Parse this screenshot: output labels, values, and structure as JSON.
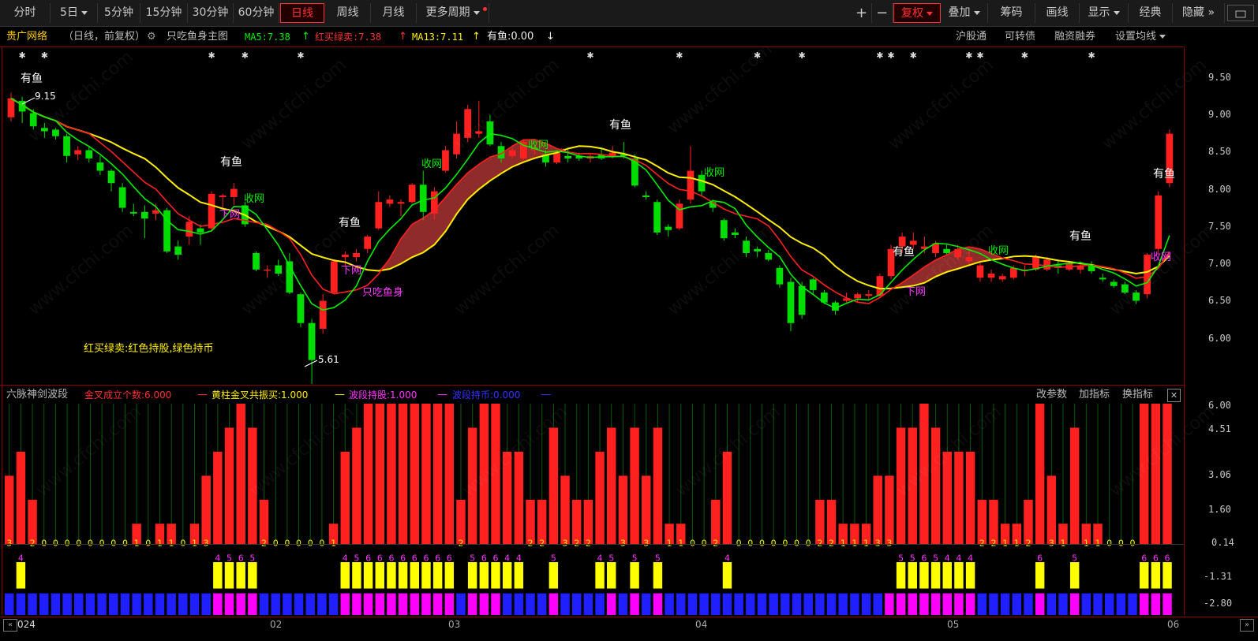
{
  "toolbar": {
    "left_tabs": [
      "分时",
      "5日",
      "5分钟",
      "15分钟",
      "30分钟",
      "60分钟",
      "日线",
      "周线",
      "月线",
      "更多周期"
    ],
    "active_tab": "日线",
    "right_buttons": [
      "复权",
      "叠加",
      "筹码",
      "画线",
      "显示",
      "经典",
      "隐藏"
    ],
    "plus": "+",
    "minus": "−",
    "hide_arrows": "»"
  },
  "info": {
    "stock_name": "贵广网络",
    "period": "（日线，前复权）",
    "template": "只吃鱼身主图",
    "ma5": "MA5:7.38",
    "hmlm": "红买绿卖:7.38",
    "ma13": "MA13:7.11",
    "youyu": "有鱼:0.00",
    "links": [
      "沪股通",
      "可转债",
      "融资融券",
      "设置均线"
    ]
  },
  "indicator": {
    "name": "六脉神剑波段",
    "l1": "金叉成立个数:6.000",
    "l2": "黄柱金叉共振买:1.000",
    "l3": "波段持股:1.000",
    "l4": "波段持币:0.000",
    "dash": "—",
    "actions": [
      "改参数",
      "加指标",
      "换指标"
    ],
    "close": "✕"
  },
  "axis": {
    "main": [
      "9.50",
      "9.00",
      "8.50",
      "8.00",
      "7.50",
      "7.00",
      "6.50",
      "6.00"
    ],
    "sub": [
      "6.00",
      "4.51",
      "3.06",
      "1.60",
      "0.14",
      "-1.31",
      "-2.80"
    ]
  },
  "dates": [
    "024",
    "02",
    "03",
    "04",
    "05",
    "06"
  ],
  "annotations": {
    "high": "9.15",
    "low": "5.61",
    "legend": "红买绿卖:红色持股,绿色持币",
    "youyu": "有鱼",
    "shouwang": "收网",
    "xiawang": "下网",
    "zcys": "只吃鱼身"
  },
  "watermark": "www.cfchi.com",
  "colors": {
    "up": "#ff2020",
    "down": "#00dd00",
    "ma5": "#00ee00",
    "ma13": "#ffee00",
    "red_line": "#ff2020",
    "band": "#a83232",
    "yellow": "#ffff00",
    "magenta": "#ff00ff",
    "blue": "#1f1fff",
    "grid": "#8b0000"
  },
  "chart_data": [
    {
      "type": "candlestick",
      "title": "贵广网络 日线 前复权",
      "y_range": [
        5.6,
        9.7
      ],
      "candles": [
        {
          "o": 8.85,
          "h": 9.15,
          "l": 8.8,
          "c": 9.08
        },
        {
          "o": 9.05,
          "h": 9.1,
          "l": 8.78,
          "c": 8.92
        },
        {
          "o": 8.9,
          "h": 8.95,
          "l": 8.7,
          "c": 8.74
        },
        {
          "o": 8.72,
          "h": 8.78,
          "l": 8.6,
          "c": 8.68
        },
        {
          "o": 8.7,
          "h": 8.72,
          "l": 8.58,
          "c": 8.62
        },
        {
          "o": 8.62,
          "h": 8.65,
          "l": 8.3,
          "c": 8.38
        },
        {
          "o": 8.4,
          "h": 8.5,
          "l": 8.33,
          "c": 8.45
        },
        {
          "o": 8.45,
          "h": 8.5,
          "l": 8.3,
          "c": 8.35
        },
        {
          "o": 8.3,
          "h": 8.38,
          "l": 8.15,
          "c": 8.2
        },
        {
          "o": 8.2,
          "h": 8.22,
          "l": 7.95,
          "c": 8.05
        },
        {
          "o": 8.0,
          "h": 8.05,
          "l": 7.7,
          "c": 7.75
        },
        {
          "o": 7.7,
          "h": 7.8,
          "l": 7.65,
          "c": 7.68
        },
        {
          "o": 7.7,
          "h": 7.78,
          "l": 7.38,
          "c": 7.62
        },
        {
          "o": 7.68,
          "h": 7.8,
          "l": 7.6,
          "c": 7.72
        },
        {
          "o": 7.72,
          "h": 7.75,
          "l": 7.2,
          "c": 7.22
        },
        {
          "o": 7.28,
          "h": 7.35,
          "l": 7.12,
          "c": 7.18
        },
        {
          "o": 7.4,
          "h": 7.65,
          "l": 7.3,
          "c": 7.58
        },
        {
          "o": 7.5,
          "h": 7.55,
          "l": 7.3,
          "c": 7.45
        },
        {
          "o": 7.5,
          "h": 7.95,
          "l": 7.48,
          "c": 7.92
        },
        {
          "o": 7.88,
          "h": 7.92,
          "l": 7.75,
          "c": 7.9
        },
        {
          "o": 7.88,
          "h": 8.05,
          "l": 7.78,
          "c": 7.98
        },
        {
          "o": 7.78,
          "h": 7.82,
          "l": 7.52,
          "c": 7.55
        },
        {
          "o": 7.2,
          "h": 7.22,
          "l": 6.98,
          "c": 7.0
        },
        {
          "o": 7.0,
          "h": 7.05,
          "l": 6.9,
          "c": 7.0
        },
        {
          "o": 7.05,
          "h": 7.12,
          "l": 6.92,
          "c": 6.95
        },
        {
          "o": 7.1,
          "h": 7.2,
          "l": 6.7,
          "c": 6.72
        },
        {
          "o": 6.7,
          "h": 6.72,
          "l": 6.3,
          "c": 6.35
        },
        {
          "o": 6.35,
          "h": 6.4,
          "l": 5.61,
          "c": 5.9
        },
        {
          "o": 6.28,
          "h": 6.7,
          "l": 6.22,
          "c": 6.62
        },
        {
          "o": 6.72,
          "h": 7.12,
          "l": 6.7,
          "c": 7.1
        },
        {
          "o": 7.15,
          "h": 7.22,
          "l": 7.05,
          "c": 7.18
        },
        {
          "o": 7.15,
          "h": 7.25,
          "l": 7.1,
          "c": 7.2
        },
        {
          "o": 7.25,
          "h": 7.42,
          "l": 7.2,
          "c": 7.4
        },
        {
          "o": 7.5,
          "h": 7.95,
          "l": 7.48,
          "c": 7.82
        },
        {
          "o": 7.8,
          "h": 7.9,
          "l": 7.76,
          "c": 7.85
        },
        {
          "o": 7.8,
          "h": 7.85,
          "l": 7.65,
          "c": 7.82
        },
        {
          "o": 7.82,
          "h": 8.05,
          "l": 7.8,
          "c": 8.03
        },
        {
          "o": 8.03,
          "h": 8.2,
          "l": 7.6,
          "c": 7.7
        },
        {
          "o": 7.68,
          "h": 8.0,
          "l": 7.6,
          "c": 7.95
        },
        {
          "o": 8.2,
          "h": 8.5,
          "l": 8.18,
          "c": 8.45
        },
        {
          "o": 8.4,
          "h": 8.8,
          "l": 8.35,
          "c": 8.65
        },
        {
          "o": 8.6,
          "h": 9.0,
          "l": 8.55,
          "c": 8.95
        },
        {
          "o": 8.65,
          "h": 9.05,
          "l": 8.6,
          "c": 8.68
        },
        {
          "o": 8.8,
          "h": 8.88,
          "l": 8.5,
          "c": 8.52
        },
        {
          "o": 8.5,
          "h": 8.55,
          "l": 8.3,
          "c": 8.35
        },
        {
          "o": 8.38,
          "h": 8.48,
          "l": 8.35,
          "c": 8.45
        },
        {
          "o": 8.35,
          "h": 8.58,
          "l": 8.33,
          "c": 8.55
        },
        {
          "o": 8.45,
          "h": 8.5,
          "l": 8.4,
          "c": 8.48
        },
        {
          "o": 8.4,
          "h": 8.45,
          "l": 8.25,
          "c": 8.3
        },
        {
          "o": 8.3,
          "h": 8.45,
          "l": 8.28,
          "c": 8.42
        },
        {
          "o": 8.38,
          "h": 8.48,
          "l": 8.3,
          "c": 8.35
        },
        {
          "o": 8.38,
          "h": 8.42,
          "l": 8.32,
          "c": 8.35
        },
        {
          "o": 8.35,
          "h": 8.4,
          "l": 8.3,
          "c": 8.38
        },
        {
          "o": 8.4,
          "h": 8.48,
          "l": 8.33,
          "c": 8.35
        },
        {
          "o": 8.38,
          "h": 8.5,
          "l": 8.35,
          "c": 8.42
        },
        {
          "o": 8.4,
          "h": 8.55,
          "l": 8.35,
          "c": 8.38
        },
        {
          "o": 8.35,
          "h": 8.4,
          "l": 8.0,
          "c": 8.02
        },
        {
          "o": 7.9,
          "h": 7.95,
          "l": 7.85,
          "c": 7.88
        },
        {
          "o": 7.82,
          "h": 7.85,
          "l": 7.42,
          "c": 7.45
        },
        {
          "o": 7.52,
          "h": 7.55,
          "l": 7.4,
          "c": 7.48
        },
        {
          "o": 7.5,
          "h": 7.85,
          "l": 7.48,
          "c": 7.8
        },
        {
          "o": 7.85,
          "h": 8.5,
          "l": 7.8,
          "c": 8.2
        },
        {
          "o": 8.15,
          "h": 8.2,
          "l": 7.9,
          "c": 7.95
        },
        {
          "o": 7.82,
          "h": 7.85,
          "l": 7.7,
          "c": 7.75
        },
        {
          "o": 7.6,
          "h": 7.62,
          "l": 7.35,
          "c": 7.38
        },
        {
          "o": 7.45,
          "h": 7.5,
          "l": 7.38,
          "c": 7.42
        },
        {
          "o": 7.35,
          "h": 7.4,
          "l": 7.15,
          "c": 7.2
        },
        {
          "o": 7.25,
          "h": 7.28,
          "l": 7.15,
          "c": 7.22
        },
        {
          "o": 7.2,
          "h": 7.24,
          "l": 7.1,
          "c": 7.12
        },
        {
          "o": 7.02,
          "h": 7.05,
          "l": 6.78,
          "c": 6.82
        },
        {
          "o": 6.85,
          "h": 6.9,
          "l": 6.25,
          "c": 6.35
        },
        {
          "o": 6.8,
          "h": 6.85,
          "l": 6.4,
          "c": 6.45
        },
        {
          "o": 6.88,
          "h": 6.9,
          "l": 6.7,
          "c": 6.75
        },
        {
          "o": 6.72,
          "h": 6.75,
          "l": 6.58,
          "c": 6.6
        },
        {
          "o": 6.6,
          "h": 6.62,
          "l": 6.45,
          "c": 6.5
        },
        {
          "o": 6.62,
          "h": 6.72,
          "l": 6.6,
          "c": 6.65
        },
        {
          "o": 6.65,
          "h": 6.72,
          "l": 6.6,
          "c": 6.7
        },
        {
          "o": 6.68,
          "h": 6.75,
          "l": 6.62,
          "c": 6.7
        },
        {
          "o": 6.68,
          "h": 6.95,
          "l": 6.66,
          "c": 6.92
        },
        {
          "o": 6.92,
          "h": 7.3,
          "l": 6.88,
          "c": 7.25
        },
        {
          "o": 7.28,
          "h": 7.45,
          "l": 7.2,
          "c": 7.4
        },
        {
          "o": 7.3,
          "h": 7.45,
          "l": 7.25,
          "c": 7.35
        },
        {
          "o": 7.25,
          "h": 7.4,
          "l": 7.2,
          "c": 7.28
        },
        {
          "o": 7.2,
          "h": 7.35,
          "l": 7.15,
          "c": 7.32
        },
        {
          "o": 7.25,
          "h": 7.3,
          "l": 7.18,
          "c": 7.2
        },
        {
          "o": 7.15,
          "h": 7.3,
          "l": 7.12,
          "c": 7.25
        },
        {
          "o": 7.1,
          "h": 7.25,
          "l": 7.05,
          "c": 7.15
        },
        {
          "o": 6.9,
          "h": 7.1,
          "l": 6.85,
          "c": 7.05
        },
        {
          "o": 6.9,
          "h": 7.0,
          "l": 6.85,
          "c": 6.95
        },
        {
          "o": 6.88,
          "h": 6.95,
          "l": 6.85,
          "c": 6.92
        },
        {
          "o": 6.9,
          "h": 7.05,
          "l": 6.88,
          "c": 7.02
        },
        {
          "o": 6.98,
          "h": 7.05,
          "l": 6.92,
          "c": 7.0
        },
        {
          "o": 7.0,
          "h": 7.18,
          "l": 6.98,
          "c": 7.15
        },
        {
          "o": 7.0,
          "h": 7.15,
          "l": 6.98,
          "c": 7.12
        },
        {
          "o": 7.05,
          "h": 7.12,
          "l": 6.95,
          "c": 7.02
        },
        {
          "o": 7.0,
          "h": 7.1,
          "l": 6.98,
          "c": 7.08
        },
        {
          "o": 7.0,
          "h": 7.1,
          "l": 6.95,
          "c": 7.05
        },
        {
          "o": 7.05,
          "h": 7.1,
          "l": 6.95,
          "c": 6.98
        },
        {
          "o": 6.9,
          "h": 6.95,
          "l": 6.85,
          "c": 6.88
        },
        {
          "o": 6.85,
          "h": 6.88,
          "l": 6.78,
          "c": 6.8
        },
        {
          "o": 6.82,
          "h": 6.85,
          "l": 6.7,
          "c": 6.72
        },
        {
          "o": 6.72,
          "h": 6.75,
          "l": 6.58,
          "c": 6.62
        },
        {
          "o": 6.7,
          "h": 7.2,
          "l": 6.65,
          "c": 7.18
        },
        {
          "o": 7.25,
          "h": 7.95,
          "l": 7.2,
          "c": 7.9
        },
        {
          "o": 8.05,
          "h": 8.7,
          "l": 8.0,
          "c": 8.65
        }
      ],
      "series_styles": {
        "ma5": "green",
        "ma13": "yellow",
        "red": "red"
      }
    },
    {
      "type": "bar",
      "title": "六脉神剑波段",
      "y_range": [
        -2.8,
        6.0
      ],
      "values": [
        3,
        4,
        2,
        0,
        0,
        0,
        0,
        0,
        0,
        0,
        0,
        1,
        0,
        1,
        1,
        0,
        1,
        3,
        4,
        5,
        6,
        5,
        2,
        0,
        0,
        0,
        0,
        0,
        1,
        4,
        5,
        6,
        6,
        6,
        6,
        6,
        6,
        6,
        6,
        2,
        5,
        6,
        6,
        4,
        4,
        2,
        2,
        5,
        3,
        2,
        2,
        4,
        5,
        3,
        5,
        3,
        5,
        1,
        1,
        0,
        0,
        2,
        4,
        0,
        0,
        0,
        0,
        0,
        0,
        0,
        2,
        2,
        1,
        1,
        1,
        3,
        3,
        5,
        5,
        6,
        5,
        4,
        4,
        4,
        2,
        2,
        1,
        1,
        2,
        6,
        3,
        1,
        5,
        1,
        1,
        0,
        0,
        0,
        6,
        6,
        6
      ],
      "digits": "3 2 0 0 0 0 0 0 0 1 0 1 1 0 1 3 ... 2 0 0 0 0 1 ... 2 ... 2 2 3 2 2 3 3 1 1 0 0 2 2 0 0 0 0 0 0 0 2 2 1 1 1 3 3 2 2 1 1 2 3 1 1 1 0 0 0"
    }
  ]
}
